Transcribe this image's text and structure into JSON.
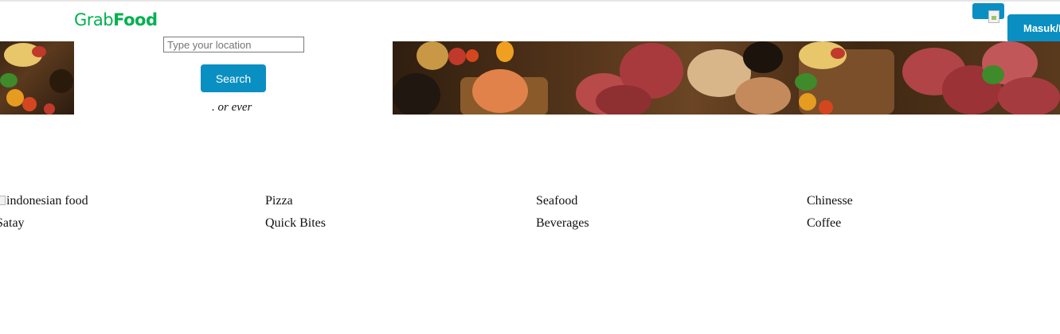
{
  "header": {
    "logo_grab": "Grab",
    "logo_food": "Food",
    "login_label": "Masuk/Daftar"
  },
  "search": {
    "placeholder": "Type your location",
    "button_label": "Search",
    "tagline": ". or ever"
  },
  "categories": [
    {
      "label": "indonesian food"
    },
    {
      "label": "Pizza"
    },
    {
      "label": "Seafood"
    },
    {
      "label": "Chinesse"
    },
    {
      "label": "Satay"
    },
    {
      "label": "Quick Bites"
    },
    {
      "label": "Beverages"
    },
    {
      "label": "Coffee"
    }
  ],
  "colors": {
    "brand_green": "#00b14f",
    "button_blue": "#0a8fc2"
  }
}
